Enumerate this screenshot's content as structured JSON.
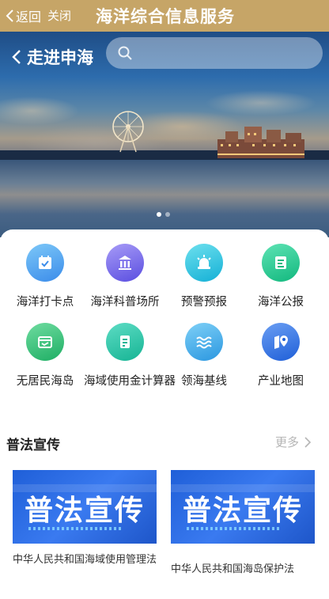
{
  "topbar": {
    "back_label": "返回",
    "close_label": "关闭",
    "title": "海洋综合信息服务"
  },
  "hero": {
    "back_title": "走进申海",
    "search_placeholder": "",
    "carousel": {
      "total": 2,
      "active_index": 0
    }
  },
  "colors": {
    "topbar": "#c6a567",
    "banner": "#1f5fd8"
  },
  "services": [
    {
      "label": "海洋打卡点",
      "icon": "calendar-check-icon",
      "color_from": "#58b6f5",
      "color_to": "#2f86e6"
    },
    {
      "label": "海洋科普场所",
      "icon": "museum-icon",
      "color_from": "#8b7cf5",
      "color_to": "#5a4ee0"
    },
    {
      "label": "预警预报",
      "icon": "alarm-light-icon",
      "color_from": "#43d6e8",
      "color_to": "#14b0d6"
    },
    {
      "label": "海洋公报",
      "icon": "bulletin-icon",
      "color_from": "#3ad6a0",
      "color_to": "#12b87e"
    },
    {
      "label": "无居民海岛",
      "icon": "island-card-icon",
      "color_from": "#4fd08a",
      "color_to": "#1eae64"
    },
    {
      "label": "海域使用金计算器",
      "icon": "calculator-icon",
      "color_from": "#3bd0b4",
      "color_to": "#16b494"
    },
    {
      "label": "领海基线",
      "icon": "waves-icon",
      "color_from": "#5ec3f5",
      "color_to": "#2b97e0"
    },
    {
      "label": "产业地图",
      "icon": "map-pin-icon",
      "color_from": "#4a86ef",
      "color_to": "#1f5fd8"
    }
  ],
  "legal": {
    "section_title": "普法宣传",
    "more_label": "更多",
    "cards": [
      {
        "banner_text": "普法宣传",
        "title": "中华人民共和国海域使用管理法"
      },
      {
        "banner_text": "普法宣传",
        "title": "中华人民共和国海岛保护法"
      }
    ]
  }
}
